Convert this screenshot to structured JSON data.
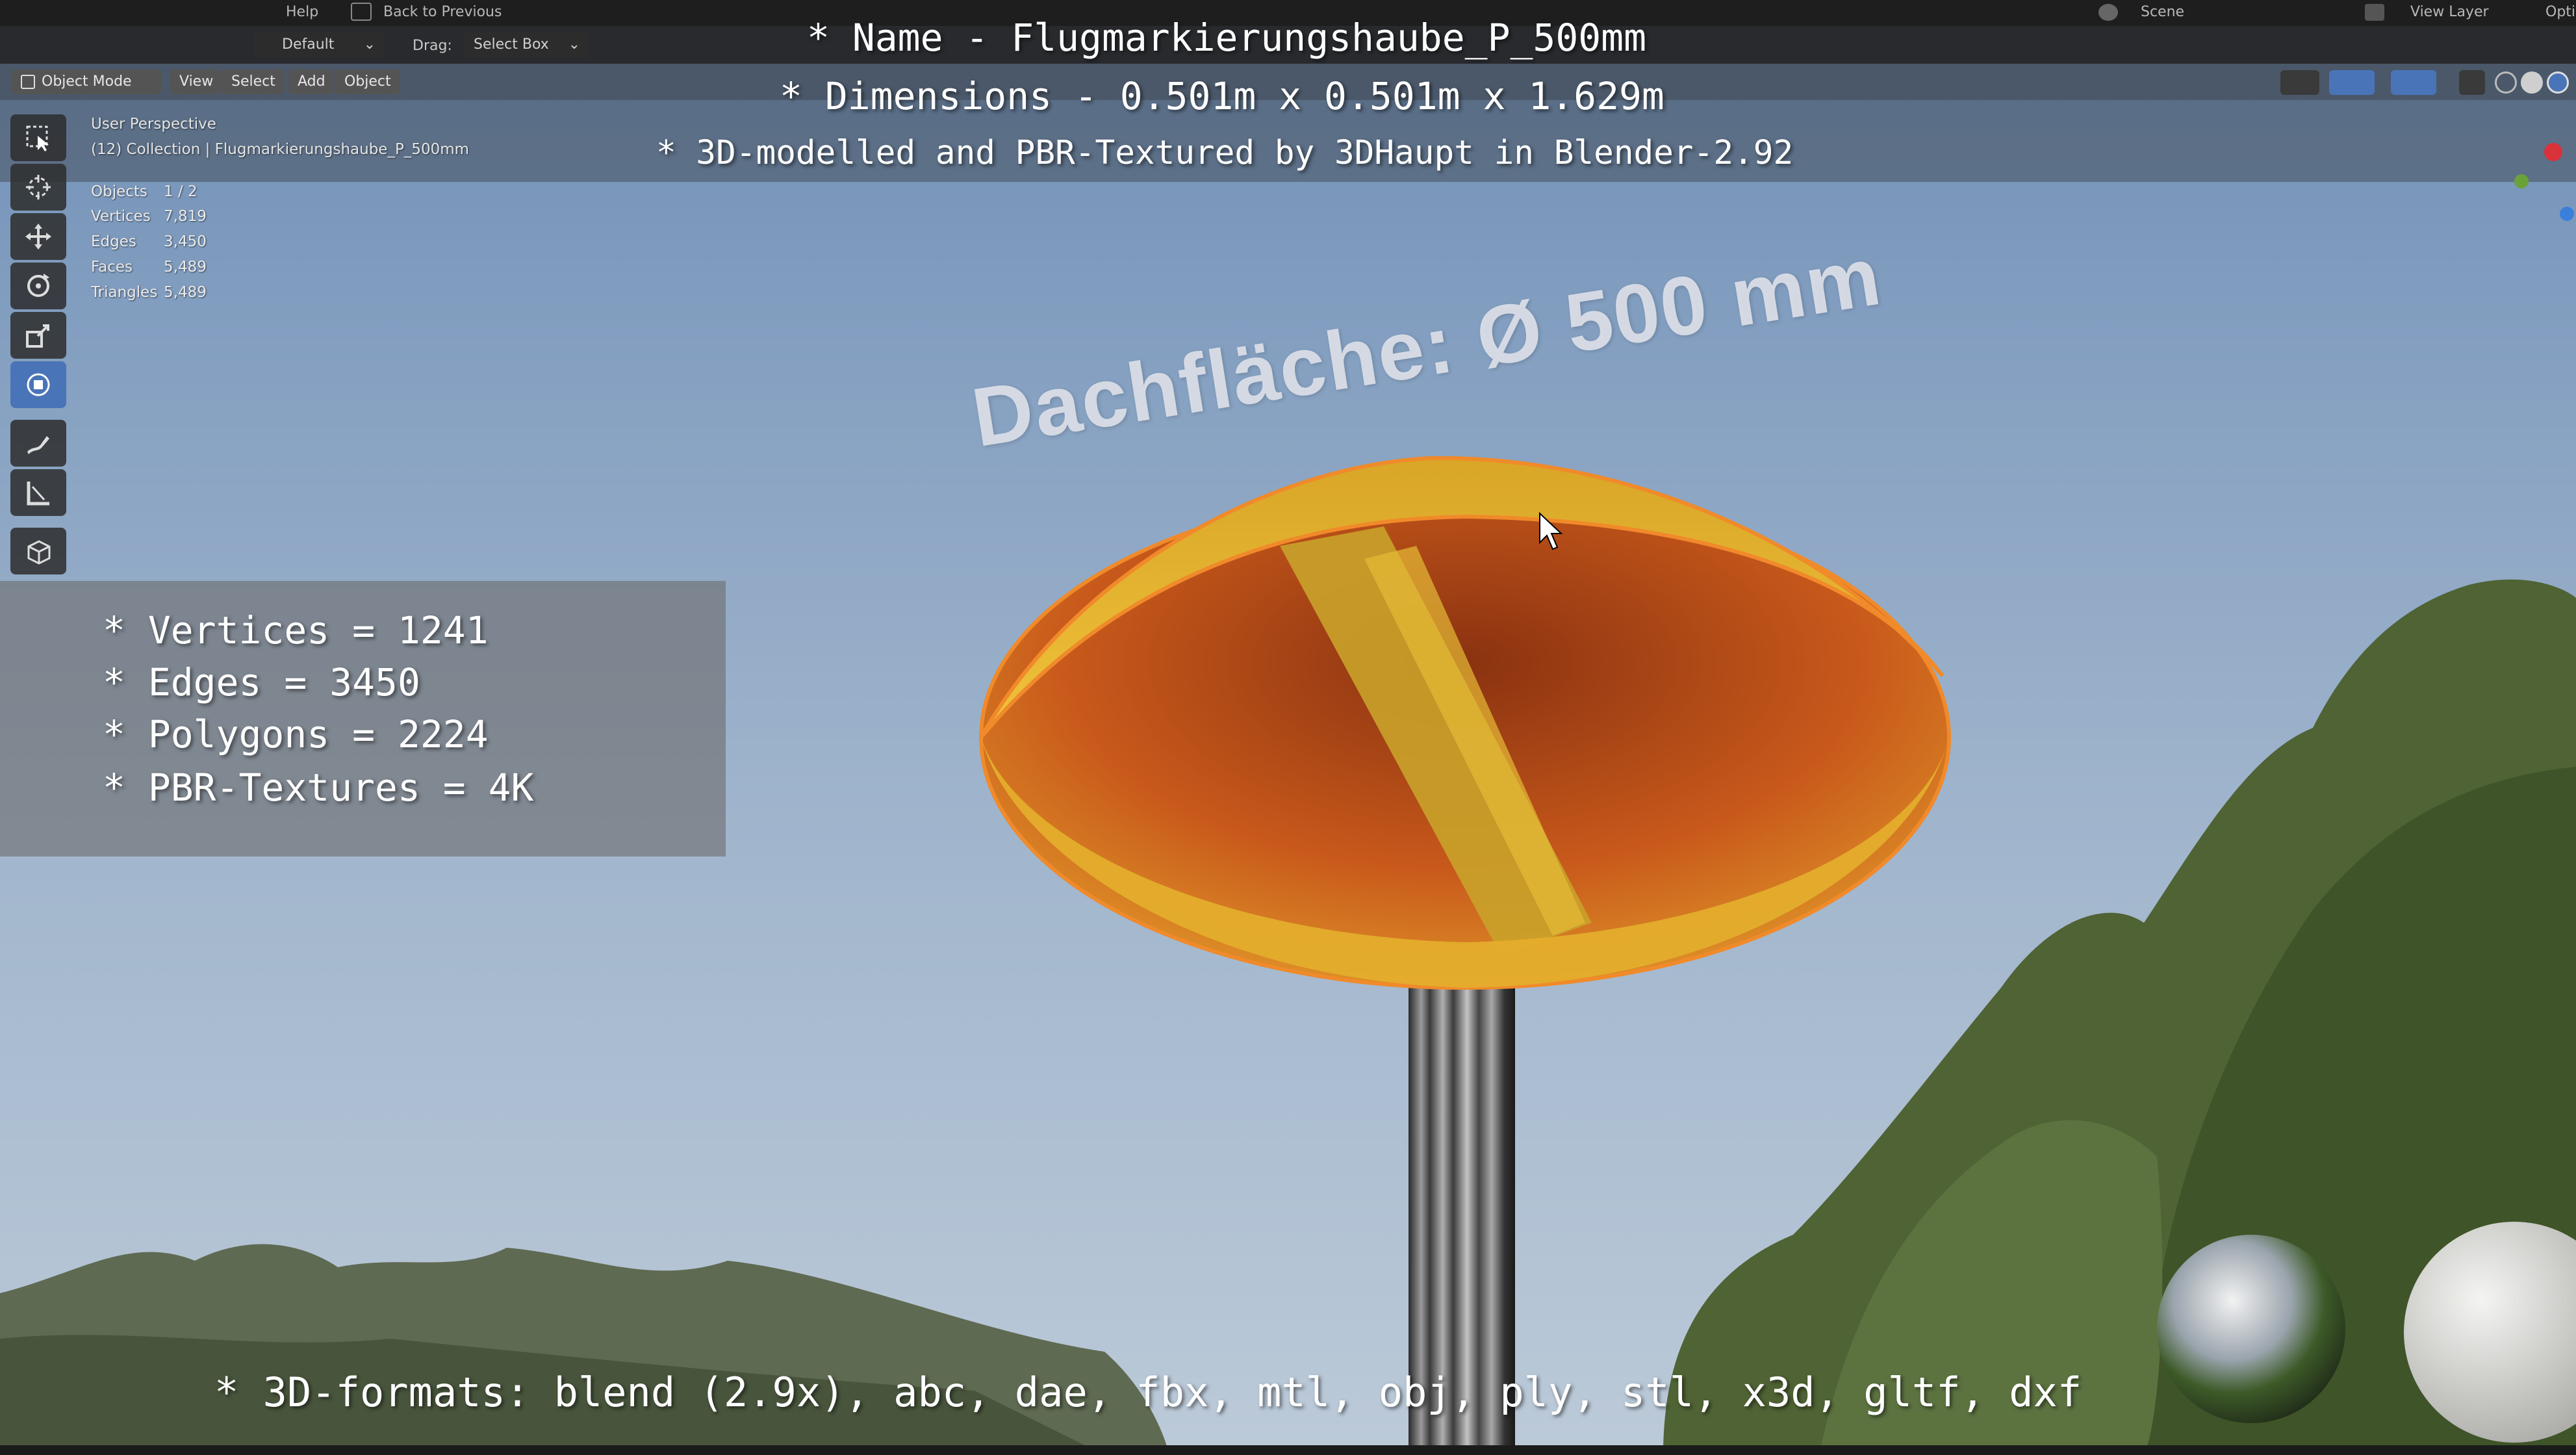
{
  "topbar": {
    "menu_help": "Help",
    "back_to_previous": "Back to Previous",
    "scene": "Scene",
    "view_layer": "View Layer",
    "options_short": "Opti"
  },
  "header": {
    "orientation_default": "Default",
    "drag_label": "Drag:",
    "drag_value": "Select Box",
    "object_mode": "Object Mode",
    "menu_view": "View",
    "menu_select": "Select",
    "menu_add": "Add",
    "menu_object": "Object"
  },
  "viewport_info": {
    "perspective": "User Perspective",
    "collection": "(12) Collection | Flugmarkierungshaube_P_500mm"
  },
  "scene_stats": [
    {
      "label": "Objects",
      "value": "1 / 2"
    },
    {
      "label": "Vertices",
      "value": "7,819"
    },
    {
      "label": "Edges",
      "value": "3,450"
    },
    {
      "label": "Faces",
      "value": "5,489"
    },
    {
      "label": "Triangles",
      "value": "5,489"
    }
  ],
  "overlay": {
    "name_line": "* Name - Flugmarkierungshaube_P_500mm",
    "dimensions_line": "* Dimensions -  0.501m x 0.501m x 1.629m",
    "credit_line": "* 3D-modelled and PBR-Textured by 3DHaupt in Blender-2.92",
    "formats_line": "* 3D-formats: blend (2.9x), abc, dae, fbx, mtl, obj, ply, stl, x3d, gltf, dxf"
  },
  "model_stats": [
    "* Vertices = 1241",
    "* Edges = 3450",
    "* Polygons = 2224",
    "* PBR-Textures = 4K"
  ],
  "annotation": "Dachfläche:  Ø 500 mm",
  "colors": {
    "sky_top": "#6f8fb7",
    "sky_bottom": "#b5c6d8",
    "cap_yellow": "#e8b52a",
    "cap_inner": "#c4581a",
    "selection_outline": "#f08a2a",
    "active_tool": "#4a74b8"
  }
}
